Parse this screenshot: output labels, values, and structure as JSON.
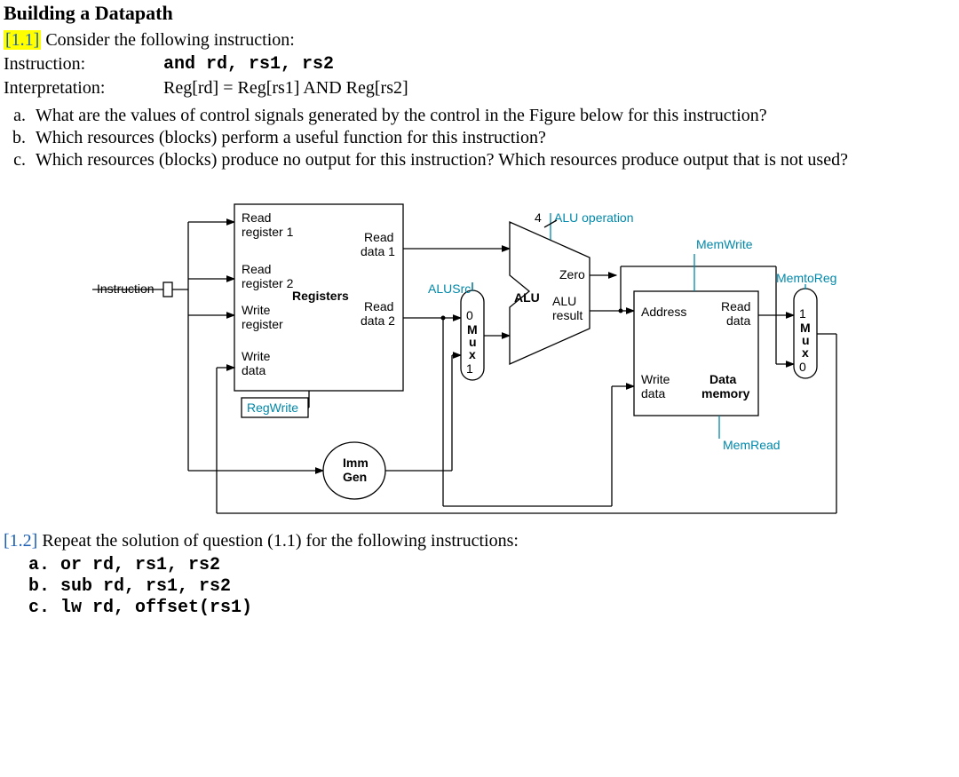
{
  "title": "Building a Datapath",
  "q1": {
    "num": "[1.1]",
    "lead": "Consider the following instruction:",
    "rows": {
      "instr_label": "Instruction:",
      "instr_code": "and rd, rs1, rs2",
      "interp_label": "Interpretation:",
      "interp_text": "Reg[rd] = Reg[rs1] AND Reg[rs2]"
    },
    "subs": {
      "a": "What are the values of control signals generated by the control in the Figure below for this instruction?",
      "b": "Which resources (blocks) perform a useful function for this instruction?",
      "c": "Which resources (blocks) produce no output for this instruction? Which resources produce output that is not used?"
    }
  },
  "diagram": {
    "instruction": "Instruction",
    "reg": {
      "rr1": "Read",
      "rr1b": "register 1",
      "rr2": "Read",
      "rr2b": "register 2",
      "wr": "Write",
      "wrb": "register",
      "wd": "Write",
      "wdb": "data",
      "name": "Registers",
      "rd1a": "Read",
      "rd1b": "data 1",
      "rd2a": "Read",
      "rd2b": "data 2"
    },
    "regwrite": "RegWrite",
    "immgen1": "Imm",
    "immgen2": "Gen",
    "alusrc": "ALUSrc",
    "mux0": "0",
    "mux1": "1",
    "muxM": "M",
    "muxu": "u",
    "muxx": "x",
    "alu": "ALU",
    "aluop_n": "4",
    "aluop_lbl": "ALU operation",
    "zero": "Zero",
    "alures1": "ALU",
    "alures2": "result",
    "mem": {
      "addr": "Address",
      "wd1": "Write",
      "wd2": "data",
      "rd1": "Read",
      "rd2": "data",
      "name1": "Data",
      "name2": "memory"
    },
    "memwrite": "MemWrite",
    "memread": "MemRead",
    "memtoreg": "MemtoReg",
    "mux2_1": "1",
    "mux2_0": "0"
  },
  "q2": {
    "num": "[1.2]",
    "lead": "Repeat the solution of question (1.1) for the following instructions:",
    "a": "a. or rd, rs1, rs2",
    "b": "b. sub rd, rs1, rs2",
    "c": "c. lw rd, offset(rs1)"
  }
}
